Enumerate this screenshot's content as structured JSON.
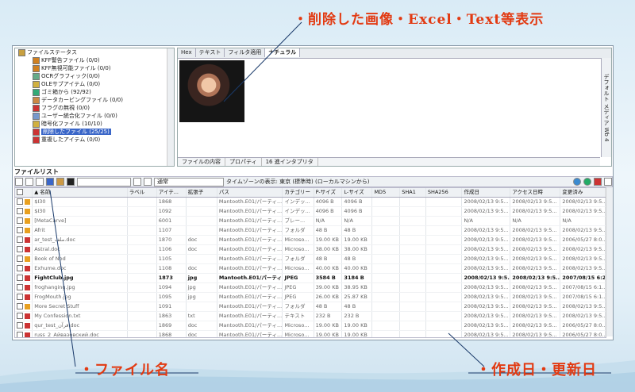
{
  "callouts": {
    "top": "・削除した画像・Excel・Text等表示",
    "file_name": "・ファイル名",
    "dates": "・作成日・更新日"
  },
  "tree": {
    "items": [
      {
        "label": "ファイルステータス",
        "color": "#c8a040"
      },
      {
        "label": "KFF警告ファイル (0/0)",
        "color": "#d08020"
      },
      {
        "label": "KFF無視可能ファイル (0/0)",
        "color": "#d08020"
      },
      {
        "label": "OCRグラフィック(0/0)",
        "color": "#6a8"
      },
      {
        "label": "OLEサブアイテム (0/0)",
        "color": "#d0b040"
      },
      {
        "label": "ゴミ箱から (92/92)",
        "color": "#3a7"
      },
      {
        "label": "データカービングファイル (0/0)",
        "color": "#c84"
      },
      {
        "label": "フラグの無視 (0/0)",
        "color": "#c33"
      },
      {
        "label": "ユーザー統合化ファイル (0/0)",
        "color": "#79c"
      },
      {
        "label": "暗号化ファイル (10/10)",
        "color": "#d0b040"
      },
      {
        "label": "削除したファイル (25/25)",
        "color": "#c33",
        "selected": true
      },
      {
        "label": "重複したアイテム (0/0)",
        "color": "#c33"
      }
    ]
  },
  "view": {
    "tabs": [
      "Hex",
      "テキスト",
      "フィルタ適用",
      "ナチュラル"
    ],
    "side_tabs": [
      "デフォルト",
      "メディア",
      "Wb",
      "4"
    ],
    "bottom_tabs": [
      "ファイルの内容",
      "プロパティ",
      "16 進インタプリタ"
    ]
  },
  "filelist": {
    "title": "ファイルリスト",
    "view_select": "通常",
    "timezone": "タイムゾーンの表示: 東京 (標準時) (ローカルマシンから)",
    "columns": [
      "",
      "名前",
      "ラベル",
      "アイテ...",
      "拡張子",
      "パス",
      "カテゴリー",
      "P-サイズ",
      "L-サイズ",
      "MD5",
      "SHA1",
      "SHA256",
      "作成日",
      "アクセス日時",
      "変更済み"
    ],
    "rows": [
      [
        "",
        "$I30",
        "",
        "1868",
        "",
        "Mantooth.E01/パーティ...",
        "インデッ...",
        "4096 B",
        "4096 B",
        "",
        "",
        "",
        "2008/02/13 9:5...",
        "2008/02/13 9:5...",
        "2008/02/13 9:5...",
        "#e8a020"
      ],
      [
        "",
        "$I30",
        "",
        "1092",
        "",
        "Mantooth.E01/パーティ...",
        "インデッ...",
        "4096 B",
        "4096 B",
        "",
        "",
        "",
        "2008/02/13 9:5...",
        "2008/02/13 9:5...",
        "2008/02/13 9:5...",
        "#e8a020"
      ],
      [
        "",
        "[MetaCarve]",
        "",
        "6001",
        "",
        "Mantooth.E01/パーティ...",
        "ブレー...",
        "N/A",
        "N/A",
        "",
        "",
        "",
        "N/A",
        "N/A",
        "N/A",
        "#e8a020"
      ],
      [
        "",
        "Afrit",
        "",
        "1107",
        "",
        "Mantooth.E01/パーティ...",
        "フォルダ",
        "48 B",
        "48 B",
        "",
        "",
        "",
        "2008/02/13 9:5...",
        "2008/02/13 9:5...",
        "2008/02/13 9:5...",
        "#e8a020"
      ],
      [
        "",
        "ar_test_ملف.doc",
        "",
        "1870",
        "doc",
        "Mantooth.E01/パーティ...",
        "Microso...",
        "19.00 KB",
        "19.00 KB",
        "",
        "",
        "",
        "2008/02/13 9:5...",
        "2008/02/13 9:5...",
        "2006/05/27 8:0...",
        "#c33"
      ],
      [
        "",
        "Astral.doc",
        "",
        "1106",
        "doc",
        "Mantooth.E01/パーティ...",
        "Microso...",
        "38.00 KB",
        "38.00 KB",
        "",
        "",
        "",
        "2008/02/13 9:5...",
        "2008/02/13 9:5...",
        "2008/02/13 9:5...",
        "#c33"
      ],
      [
        "",
        "Book of Nod",
        "",
        "1105",
        "",
        "Mantooth.E01/パーティ...",
        "フォルダ",
        "48 B",
        "48 B",
        "",
        "",
        "",
        "2008/02/13 9:5...",
        "2008/02/13 9:5...",
        "2008/02/13 9:5...",
        "#e8a020"
      ],
      [
        "",
        "Exhume.doc",
        "",
        "1108",
        "doc",
        "Mantooth.E01/パーティ...",
        "Microso...",
        "40.00 KB",
        "40.00 KB",
        "",
        "",
        "",
        "2008/02/13 9:5...",
        "2008/02/13 9:5...",
        "2008/02/13 9:5...",
        "#c33"
      ],
      [
        "",
        "FightClub.jpg",
        "",
        "1873",
        "jpg",
        "Mantooth.E01/パーティ...",
        "JPEG",
        "3584 B",
        "3184 B",
        "",
        "",
        "",
        "2008/02/13 9:5...",
        "2008/02/13 9:5...",
        "2007/08/15 6:2...",
        "#c33",
        "bold"
      ],
      [
        "",
        "froghanging.jpg",
        "",
        "1094",
        "jpg",
        "Mantooth.E01/パーティ...",
        "JPEG",
        "39.00 KB",
        "38.95 KB",
        "",
        "",
        "",
        "2008/02/13 9:5...",
        "2008/02/13 9:5...",
        "2007/08/15 6:1...",
        "#c33"
      ],
      [
        "",
        "FrogMouth.jpg",
        "",
        "1095",
        "jpg",
        "Mantooth.E01/パーティ...",
        "JPEG",
        "26.00 KB",
        "25.87 KB",
        "",
        "",
        "",
        "2008/02/13 9:5...",
        "2008/02/13 9:5...",
        "2007/08/15 6:1...",
        "#c33"
      ],
      [
        "",
        "More Secret Stuff",
        "",
        "1091",
        "",
        "Mantooth.E01/パーティ...",
        "フォルダ",
        "48 B",
        "48 B",
        "",
        "",
        "",
        "2008/02/13 9:5...",
        "2008/02/13 9:5...",
        "2008/02/13 9:5...",
        "#e8a020"
      ],
      [
        "",
        "My Confession.txt",
        "",
        "1863",
        "txt",
        "Mantooth.E01/パーティ...",
        "テキスト",
        "232 B",
        "232 B",
        "",
        "",
        "",
        "2008/02/13 9:5...",
        "2008/02/13 9:5...",
        "2008/02/13 9:5...",
        "#c33"
      ],
      [
        "",
        "qur_test_قرآن.doc",
        "",
        "1869",
        "doc",
        "Mantooth.E01/パーティ...",
        "Microso...",
        "19.00 KB",
        "19.00 KB",
        "",
        "",
        "",
        "2008/02/13 9:5...",
        "2008/02/13 9:5...",
        "2006/05/27 8:0...",
        "#c33"
      ],
      [
        "",
        "russ_2_Айвазовский.doc",
        "",
        "1868",
        "doc",
        "Mantooth.E01/パーティ...",
        "Microso...",
        "19.00 KB",
        "19.00 KB",
        "",
        "",
        "",
        "2008/02/13 9:5...",
        "2008/02/13 9:5...",
        "2006/05/27 8:0...",
        "#c33"
      ]
    ]
  }
}
